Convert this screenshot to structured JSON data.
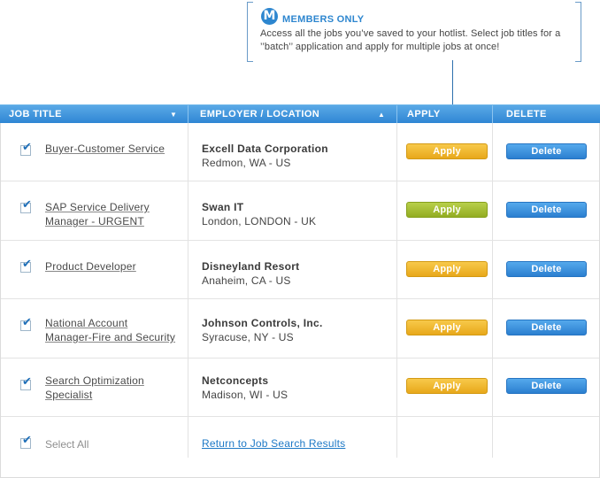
{
  "callout": {
    "badge": "M",
    "title": "MEMBERS ONLY",
    "description": "Access all the jobs you’ve saved to your hotlist. Select job titles for a ’’batch’’ application and apply for multiple jobs at once!"
  },
  "headers": {
    "job_title": "JOB TITLE",
    "employer": "EMPLOYER / LOCATION",
    "apply": "APPLY",
    "delete": "DELETE",
    "job_title_sort": "▼",
    "employer_sort": "▲"
  },
  "rows": [
    {
      "title1": "Buyer-Customer Service",
      "title2": "",
      "employer": "Excell Data Corporation",
      "location": "Redmon, WA - US",
      "apply": "Apply",
      "delete": "Delete",
      "checked": true
    },
    {
      "title1": "SAP Service Delivery",
      "title2": "Manager - URGENT",
      "employer": "Swan IT",
      "location": "London, LONDON - UK",
      "apply": "Apply",
      "delete": "Delete",
      "checked": true
    },
    {
      "title1": "Product Developer",
      "title2": "",
      "employer": "Disneyland Resort",
      "location": "Anaheim, CA - US",
      "apply": "Apply",
      "delete": "Delete",
      "checked": true
    },
    {
      "title1": "National Account",
      "title2": "Manager-Fire and Security",
      "employer": "Johnson Controls, Inc.",
      "location": "Syracuse, NY - US",
      "apply": "Apply",
      "delete": "Delete",
      "checked": true
    },
    {
      "title1": "Search Optimization",
      "title2": "Specialist",
      "employer": "Netconcepts",
      "location": "Madison, WI - US",
      "apply": "Apply",
      "delete": "Delete",
      "checked": true
    }
  ],
  "footer": {
    "select_all": "Select All",
    "return_link": "Return to Job Search Results"
  },
  "colors": {
    "header_blue": "#2f86d4",
    "apply_orange": "#f0b529",
    "apply_green": "#a3bd33",
    "delete_blue": "#3a8fde",
    "link_blue": "#1e79c6"
  },
  "icons": {
    "checkbox": "checkmark-icon",
    "members_badge": "m-badge-icon"
  }
}
